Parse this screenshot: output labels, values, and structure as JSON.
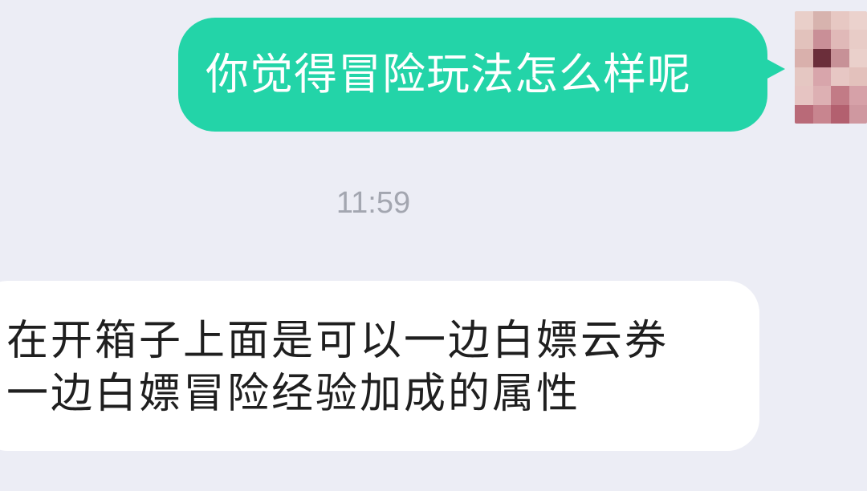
{
  "messages": [
    {
      "role": "sent",
      "text": "你觉得冒险玩法怎么样呢"
    },
    {
      "role": "timestamp",
      "text": "11:59"
    },
    {
      "role": "received",
      "lines": [
        "在开箱子上面是可以一边白嫖云券",
        "一边白嫖冒险经验加成的属性"
      ]
    }
  ],
  "colors": {
    "sent_bubble": "#23D4A8",
    "received_bubble": "#FFFFFF",
    "background": "#ECEDF5",
    "timestamp": "#A3A6B0"
  },
  "avatar": {
    "icon": "pixelated-avatar-icon",
    "pixels": [
      "#E9CFC9",
      "#D7B3AE",
      "#E7C8C3",
      "#EBD2CD",
      "#E2C2BC",
      "#C98F97",
      "#E0B9B8",
      "#E8CCC7",
      "#D9B0AC",
      "#6B2E3A",
      "#C79197",
      "#EAD0CB",
      "#E5C7C2",
      "#D8A5AB",
      "#E7C7C4",
      "#E3C1BC",
      "#E6C4C2",
      "#DDB0B3",
      "#C27B86",
      "#D6A1A8",
      "#B96A78",
      "#C8858F",
      "#B3606F",
      "#CF98A0"
    ]
  }
}
